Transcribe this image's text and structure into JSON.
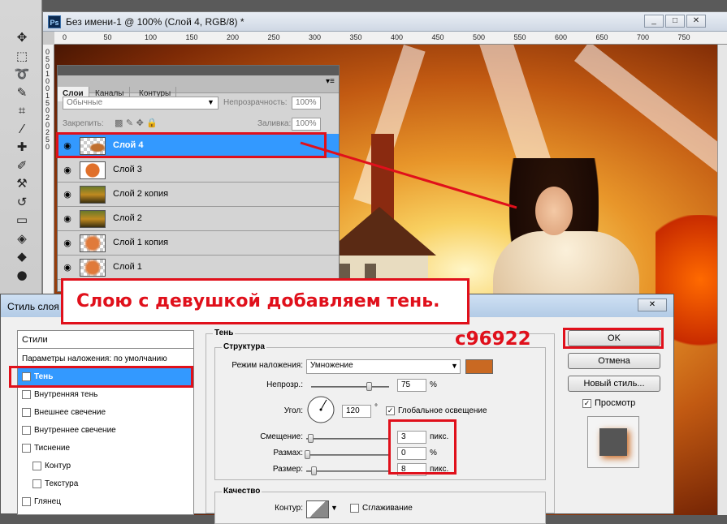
{
  "document": {
    "title": "Без имени-1 @ 100% (Слой 4, RGB/8) *",
    "logo": "Ps",
    "window_buttons": [
      "_",
      "□",
      "✕"
    ],
    "ruler_ticks": [
      "0",
      "50",
      "100",
      "150",
      "200",
      "250",
      "300",
      "350",
      "400",
      "450",
      "500",
      "550",
      "600",
      "650",
      "700",
      "750"
    ],
    "ruler_v_ticks": [
      "0",
      "5",
      "0",
      "1",
      "0",
      "0",
      "1",
      "5",
      "0",
      "2",
      "0",
      "2",
      "5",
      "0"
    ]
  },
  "tools": [
    "move-icon",
    "marquee-icon",
    "lasso-icon",
    "quick-select-icon",
    "crop-icon",
    "eyedropper-icon",
    "healing-icon",
    "brush-icon",
    "stamp-icon",
    "history-brush-icon",
    "eraser-icon",
    "paint-bucket-icon",
    "blur-icon",
    "dodge-icon"
  ],
  "layers_panel": {
    "tabs": [
      "Слои",
      "Каналы",
      "Контуры"
    ],
    "blend_mode": "Обычные",
    "opacity_label": "Непрозрачность:",
    "opacity_value": "100%",
    "lock_label": "Закрепить:",
    "fill_label": "Заливка:",
    "fill_value": "100%",
    "layers": [
      {
        "name": "Слой 4",
        "selected": true,
        "thumb": "checker-girl"
      },
      {
        "name": "Слой 3",
        "selected": false,
        "thumb": "orange-circle"
      },
      {
        "name": "Слой 2 копия",
        "selected": false,
        "thumb": "landscape"
      },
      {
        "name": "Слой 2",
        "selected": false,
        "thumb": "landscape"
      },
      {
        "name": "Слой 1 копия",
        "selected": false,
        "thumb": "checker-orange"
      },
      {
        "name": "Слой 1",
        "selected": false,
        "thumb": "checker-orange"
      }
    ]
  },
  "annotation": {
    "banner": "Слою с девушкой добавляем тень.",
    "color_code": "c96922"
  },
  "dialog": {
    "title": "Стиль слоя",
    "close": "✕",
    "styles_header": "Стили",
    "styles": [
      {
        "label": "Параметры наложения: по умолчанию",
        "checkbox": false,
        "checked": false,
        "selected": false,
        "indent": false
      },
      {
        "label": "Тень",
        "checkbox": true,
        "checked": true,
        "selected": true,
        "indent": false
      },
      {
        "label": "Внутренняя тень",
        "checkbox": true,
        "checked": false,
        "selected": false,
        "indent": false
      },
      {
        "label": "Внешнее свечение",
        "checkbox": true,
        "checked": false,
        "selected": false,
        "indent": false
      },
      {
        "label": "Внутреннее свечение",
        "checkbox": true,
        "checked": false,
        "selected": false,
        "indent": false
      },
      {
        "label": "Тиснение",
        "checkbox": true,
        "checked": false,
        "selected": false,
        "indent": false
      },
      {
        "label": "Контур",
        "checkbox": true,
        "checked": false,
        "selected": false,
        "indent": true
      },
      {
        "label": "Текстура",
        "checkbox": true,
        "checked": false,
        "selected": false,
        "indent": true
      },
      {
        "label": "Глянец",
        "checkbox": true,
        "checked": false,
        "selected": false,
        "indent": false
      }
    ],
    "shadow_group": "Тень",
    "structure_group": "Структура",
    "blend_label": "Режим наложения:",
    "blend_value": "Умножение",
    "shadow_color": "#c96922",
    "opacity_label": "Непрозр.:",
    "opacity_value": "75",
    "opacity_unit": "%",
    "opacity_fraction": 0.75,
    "angle_label": "Угол:",
    "angle_value": "120",
    "angle_unit": "°",
    "global_light_label": "Глобальное освещение",
    "distance_label": "Смещение:",
    "distance_value": "3",
    "distance_unit": "пикс.",
    "spread_label": "Размах:",
    "spread_value": "0",
    "spread_unit": "%",
    "size_label": "Размер:",
    "size_value": "8",
    "size_unit": "пикс.",
    "quality_group": "Качество",
    "contour_label": "Контур:",
    "antialias_label": "Сглаживание",
    "ok": "OK",
    "cancel": "Отмена",
    "new_style": "Новый стиль...",
    "preview_label": "Просмотр"
  }
}
